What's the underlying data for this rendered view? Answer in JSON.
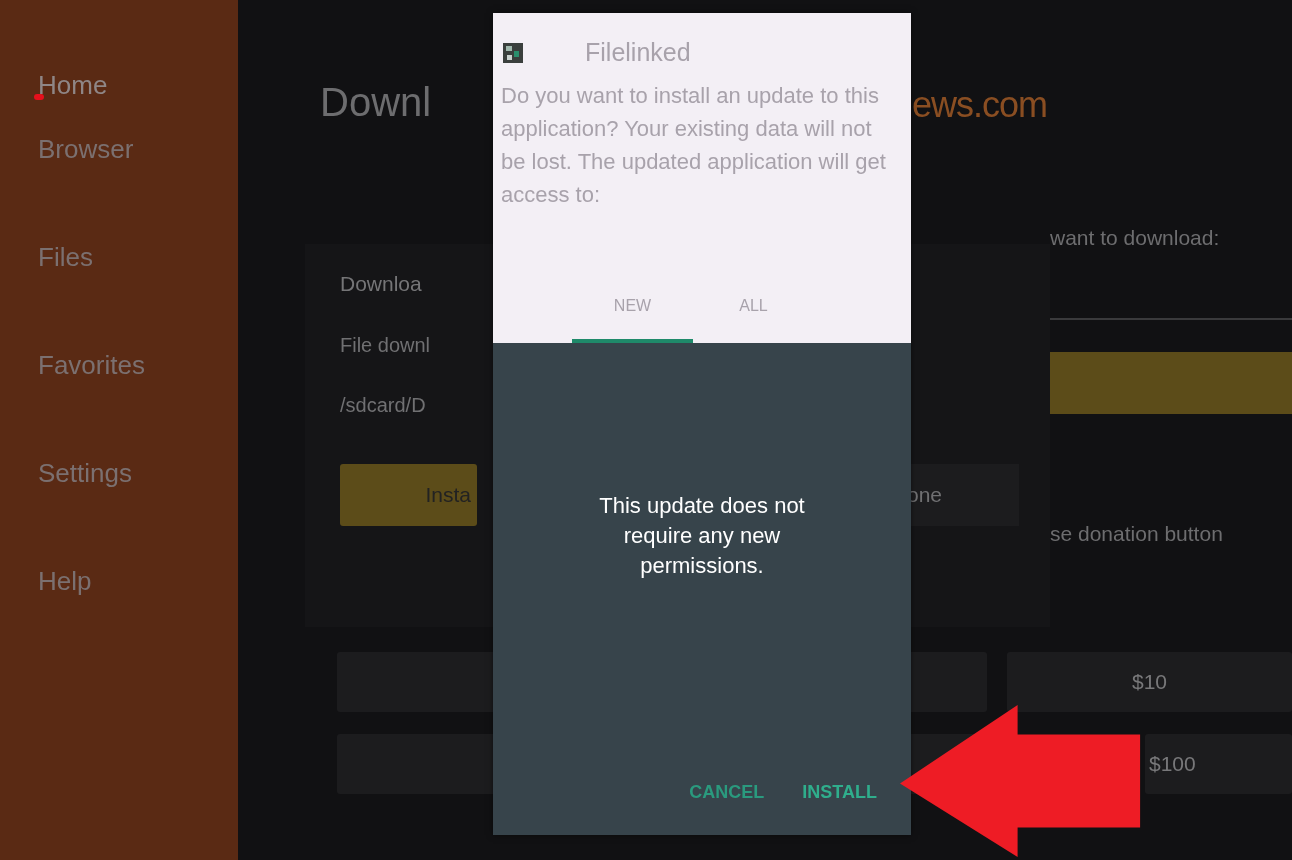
{
  "sidebar": {
    "items": [
      {
        "label": "Home",
        "selected": true
      },
      {
        "label": "Browser",
        "selected": false
      },
      {
        "label": "Files",
        "selected": false
      },
      {
        "label": "Favorites",
        "selected": false
      },
      {
        "label": "Settings",
        "selected": false
      },
      {
        "label": "Help",
        "selected": false
      }
    ]
  },
  "page": {
    "title_left": "Downl",
    "title_right": "ews.com"
  },
  "download_card": {
    "title": "Downloa",
    "status": "File downl",
    "path": "/sdcard/D",
    "install_button": "Insta",
    "done_button": "one"
  },
  "side_panel": {
    "prompt": "want to download:",
    "donation_note": "se donation button"
  },
  "donation_buttons": [
    {
      "label": "$10"
    },
    {
      "label": "$100"
    }
  ],
  "dialog": {
    "app_name": "Filelinked",
    "message": "Do you want to install an update to this application? Your existing data will not be lost. The updated application will get access to:",
    "tabs": [
      {
        "label": "NEW",
        "selected": true
      },
      {
        "label": "ALL",
        "selected": false
      }
    ],
    "notice": "This update does not require any new permissions.",
    "buttons": [
      {
        "label": "CANCEL",
        "kind": "cancel"
      },
      {
        "label": "INSTALL",
        "kind": "confirm"
      }
    ]
  }
}
